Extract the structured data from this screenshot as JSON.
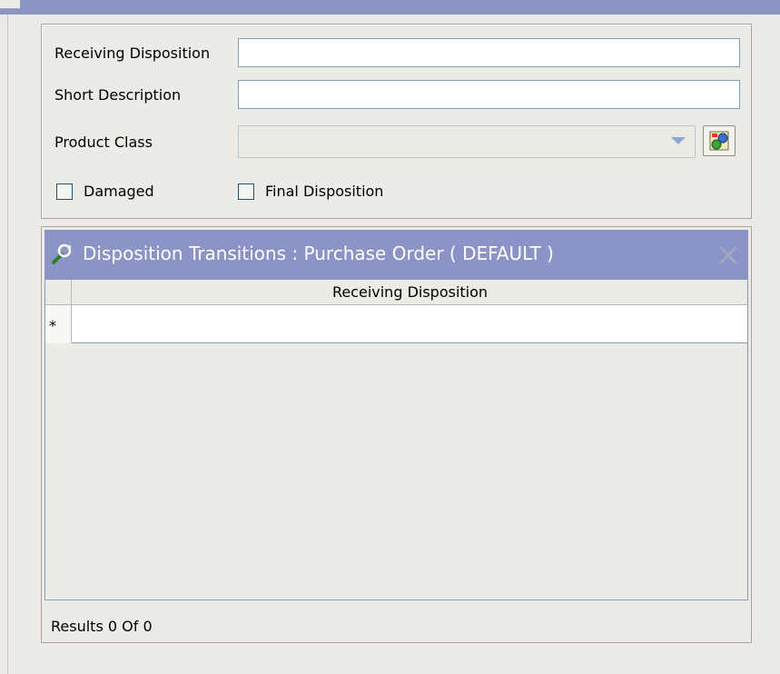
{
  "form": {
    "receiving_disposition_label": "Receiving Disposition",
    "receiving_disposition_value": "",
    "short_description_label": "Short Description",
    "short_description_value": "",
    "product_class_label": "Product Class",
    "product_class_value": "",
    "damaged_label": "Damaged",
    "damaged_checked": false,
    "final_disposition_label": "Final Disposition",
    "final_disposition_checked": false
  },
  "grid": {
    "title": "Disposition Transitions : Purchase Order ( DEFAULT )",
    "columns": [
      "Receiving Disposition"
    ],
    "new_row_marker": "*",
    "rows": [],
    "results_label": "Results 0  Of 0"
  },
  "icons": {
    "lookup": "lookup-icon",
    "title": "key-wrench-icon",
    "close": "close-icon",
    "dropdown": "chevron-down-icon"
  },
  "colors": {
    "title_bar": "#8c93c6",
    "background": "#ecebe6",
    "input_border": "#7f9db9"
  }
}
